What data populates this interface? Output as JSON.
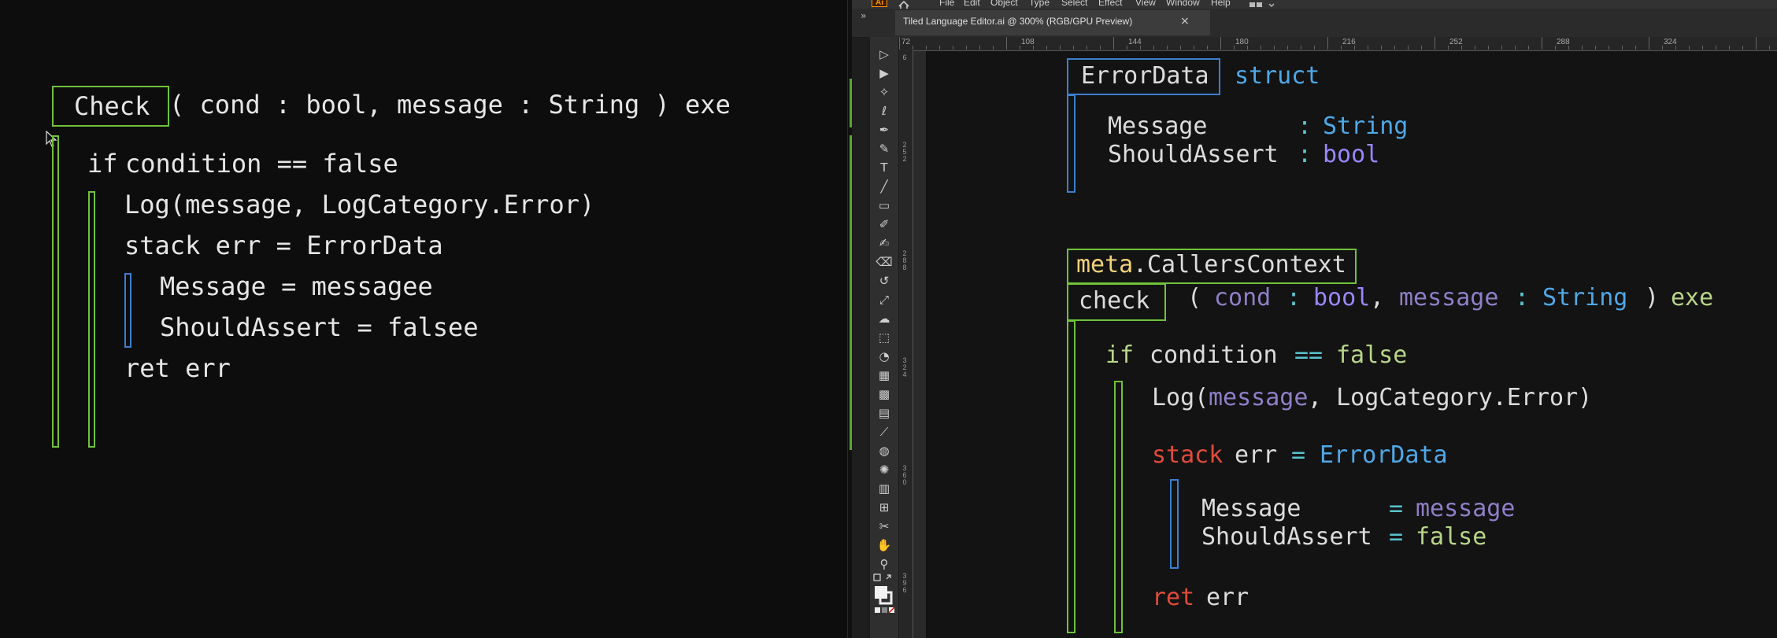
{
  "left": {
    "signature": {
      "fn_name": "Check",
      "params": "( cond : bool, message : String ) exe"
    },
    "lines": {
      "if": "if",
      "condition": "condition == false",
      "log": "Log(message, LogCategory.Error)",
      "stack": "stack err = ErrorData",
      "message_assign": "Message = messagee",
      "assert_assign": "ShouldAssert = falsee",
      "ret": "ret err"
    }
  },
  "app": {
    "menu": [
      "File",
      "Edit",
      "Object",
      "Type",
      "Select",
      "Effect",
      "View",
      "Window",
      "Help"
    ],
    "logo": "Ai",
    "tab": {
      "title": "Tiled Language Editor.ai @ 300% (RGB/GPU Preview)",
      "close": "×"
    },
    "panel_collapse": "»",
    "ruler_top": [
      "72",
      "108",
      "144",
      "180",
      "216",
      "252",
      "288",
      "324"
    ],
    "ruler_left": [
      "6",
      "2\n5\n2",
      "2\n8\n8",
      "3\n2\n4",
      "3\n6\n0",
      "3\n9\n6"
    ],
    "tools": [
      {
        "name": "selection-tool-icon",
        "glyph": "▷"
      },
      {
        "name": "direct-selection-tool-icon",
        "glyph": "▶"
      },
      {
        "name": "magic-wand-tool-icon",
        "glyph": "✧"
      },
      {
        "name": "lasso-tool-icon",
        "glyph": "ℓ"
      },
      {
        "name": "pen-tool-icon",
        "glyph": "✒"
      },
      {
        "name": "curvature-tool-icon",
        "glyph": "✎"
      },
      {
        "name": "type-tool-icon",
        "glyph": "T"
      },
      {
        "name": "line-tool-icon",
        "glyph": "╱"
      },
      {
        "name": "rectangle-tool-icon",
        "glyph": "▭"
      },
      {
        "name": "paintbrush-tool-icon",
        "glyph": "✐"
      },
      {
        "name": "shaper-tool-icon",
        "glyph": "✍"
      },
      {
        "name": "eraser-tool-icon",
        "glyph": "⌫"
      },
      {
        "name": "rotate-tool-icon",
        "glyph": "↺"
      },
      {
        "name": "scale-tool-icon",
        "glyph": "⤢"
      },
      {
        "name": "warp-tool-icon",
        "glyph": "☁"
      },
      {
        "name": "free-transform-tool-icon",
        "glyph": "⬚"
      },
      {
        "name": "shape-builder-tool-icon",
        "glyph": "◔"
      },
      {
        "name": "perspective-grid-tool-icon",
        "glyph": "▦"
      },
      {
        "name": "mesh-tool-icon",
        "glyph": "▩"
      },
      {
        "name": "gradient-tool-icon",
        "glyph": "▤"
      },
      {
        "name": "eyedropper-tool-icon",
        "glyph": "⟋"
      },
      {
        "name": "blend-tool-icon",
        "glyph": "◍"
      },
      {
        "name": "symbol-sprayer-tool-icon",
        "glyph": "✺"
      },
      {
        "name": "column-graph-tool-icon",
        "glyph": "▥"
      },
      {
        "name": "artboard-tool-icon",
        "glyph": "⊞"
      },
      {
        "name": "slice-tool-icon",
        "glyph": "✂"
      },
      {
        "name": "hand-tool-icon",
        "glyph": "✋"
      },
      {
        "name": "zoom-tool-icon",
        "glyph": "⚲"
      }
    ],
    "canvas": {
      "struct_name": "ErrorData",
      "struct_kw": "struct",
      "field1_name": "Message",
      "field1_type": "String",
      "field2_name": "ShouldAssert",
      "field2_type": "bool",
      "meta_prefix": "meta",
      "meta_name": "CallersContext",
      "fn_name": "check",
      "sig": {
        "open": "(",
        "p1": "cond",
        "p1_type": "bool",
        "p2": "message",
        "p2_type": "String",
        "close": ")",
        "exe": "exe"
      },
      "if_kw": "if",
      "if_cond": "condition",
      "if_val": "false",
      "log_fn": "Log(",
      "log_arg": "message",
      "log_rest": ", LogCategory.Error)",
      "stack_kw": "stack",
      "err_var": "err",
      "err_type": "ErrorData",
      "assign1_name": "Message",
      "assign1_val": "message",
      "assign2_name": "ShouldAssert",
      "assign2_val": "false",
      "ret_kw": "ret",
      "ret_var": "err"
    },
    "colors": {
      "green_frame": "#6fc23a",
      "blue_frame": "#3b7fd0"
    }
  }
}
